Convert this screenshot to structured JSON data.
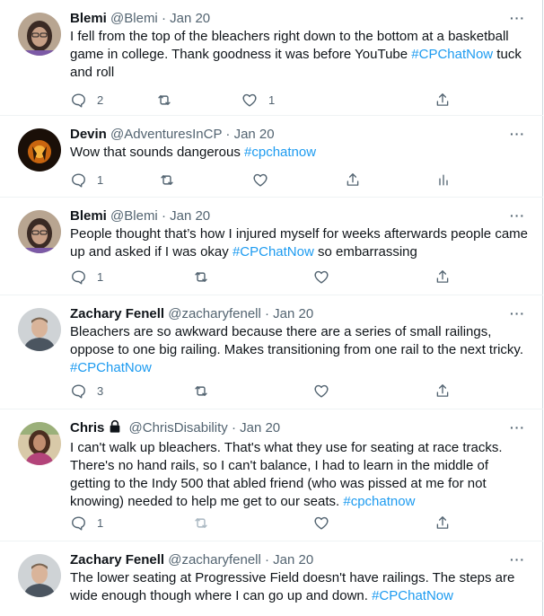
{
  "tweets": [
    {
      "name": "Blemi",
      "handle": "@Blemi",
      "date": "Jan 20",
      "avatar_icon": "blemi-avatar",
      "text_parts": [
        "I fell from the top of the bleachers right down to the bottom at a basketball game in college. Thank goodness it was before YouTube ",
        "#CPChatNow",
        " tuck and roll"
      ],
      "replies": "2",
      "retweets": "",
      "likes": "1",
      "extra_action": "share-icon"
    },
    {
      "name": "Devin",
      "handle": "@AdventuresInCP",
      "date": "Jan 20",
      "avatar_icon": "devin-avatar",
      "text_parts": [
        "Wow that sounds dangerous ",
        "#cpchatnow",
        ""
      ],
      "replies": "1",
      "retweets": "",
      "likes": "",
      "extra_action": "analytics-icon"
    },
    {
      "name": "Blemi",
      "handle": "@Blemi",
      "date": "Jan 20",
      "avatar_icon": "blemi-avatar",
      "text_parts": [
        "People thought that’s how I injured myself for weeks afterwards people came up and asked if I was okay ",
        "#CPChatNow",
        " so embarrassing"
      ],
      "replies": "1",
      "retweets": "",
      "likes": "",
      "extra_action": "share-icon"
    },
    {
      "name": "Zachary Fenell",
      "handle": "@zacharyfenell",
      "date": "Jan 20",
      "avatar_icon": "zachary-avatar",
      "text_parts": [
        "Bleachers are so awkward because there are a series of small railings, oppose to one big railing. Makes transitioning from one rail to the next tricky. ",
        "#CPChatNow",
        ""
      ],
      "replies": "3",
      "retweets": "",
      "likes": "",
      "extra_action": "share-icon"
    },
    {
      "name": "Chris",
      "handle": "@ChrisDisability",
      "date": "Jan 20",
      "avatar_icon": "chris-avatar",
      "protected_icon": "lock-icon",
      "text_parts": [
        "I can't walk up bleachers. That's what they use for seating at race tracks. There's no hand rails, so I can't balance, I had to learn in the middle of getting to the Indy 500 that abled friend (who was pissed at me for not knowing) needed to help me get to our seats.  ",
        "#cpchatnow",
        ""
      ],
      "replies": "1",
      "retweets": "",
      "likes": "",
      "extra_action": "share-icon"
    },
    {
      "name": "Zachary Fenell",
      "handle": "@zacharyfenell",
      "date": "Jan 20",
      "avatar_icon": "zachary-avatar",
      "text_parts": [
        "The lower seating at Progressive Field doesn't have railings. The steps are wide enough though where I can go up and down. ",
        "#CPChatNow",
        ""
      ]
    }
  ],
  "separator": "·",
  "more_label": "···",
  "colors": {
    "link": "#1d9bf0",
    "muted": "#536471",
    "text": "#0f1419"
  }
}
